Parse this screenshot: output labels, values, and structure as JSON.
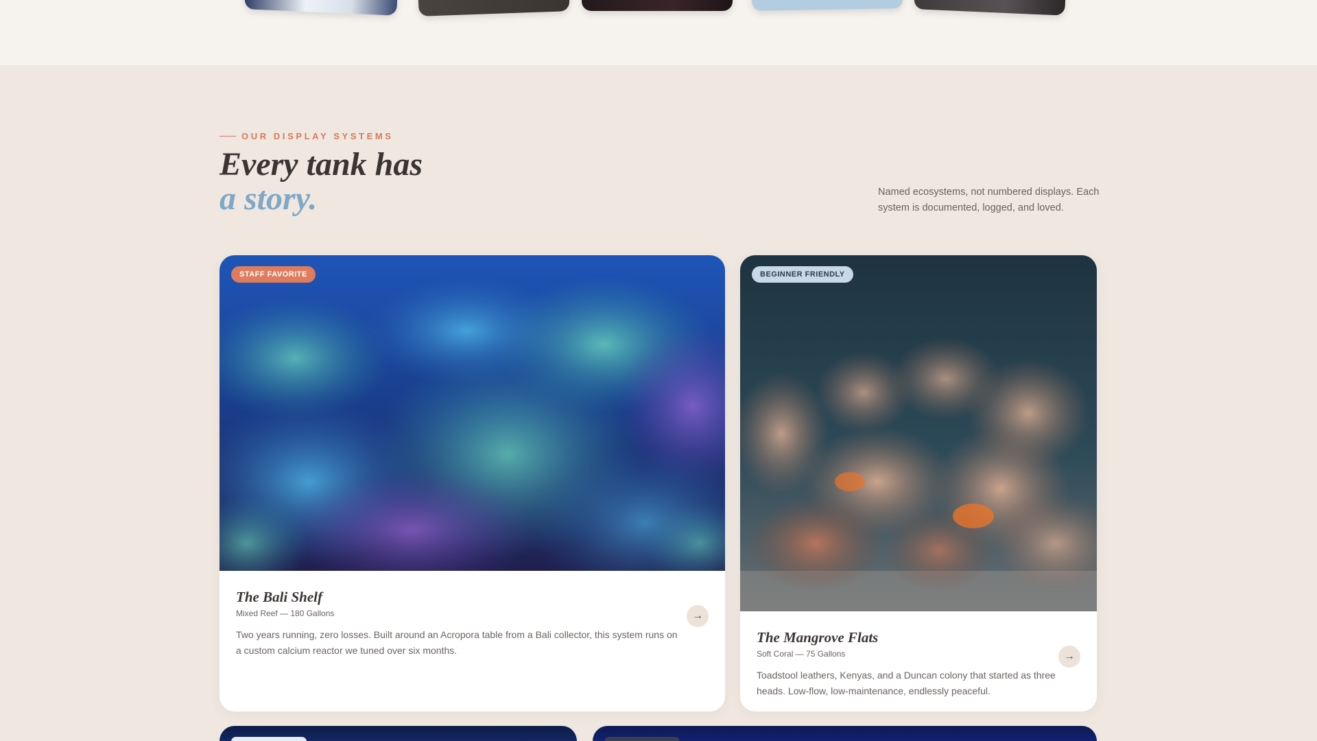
{
  "section": {
    "eyebrow": "OUR DISPLAY SYSTEMS",
    "title_line1": "Every tank has",
    "title_line2": "a story.",
    "intro": "Named ecosystems, not numbered displays. Each system is documented, logged, and loved."
  },
  "cards": [
    {
      "badge": "STAFF FAVORITE",
      "title": "The Bali Shelf",
      "subtitle": "Mixed Reef — 180 Gallons",
      "description": "Two years running, zero losses. Built around an Acropora table from a Bali collector, this system runs on a custom calcium reactor we tuned over six months.",
      "arrow": "→"
    },
    {
      "badge": "BEGINNER FRIENDLY",
      "title": "The Mangrove Flats",
      "subtitle": "Soft Coral — 75 Gallons",
      "description": "Toadstool leathers, Kenyas, and a Duncan colony that started as three heads. Low-flow, low-maintenance, endlessly peaceful.",
      "arrow": "→"
    }
  ],
  "colors": {
    "accent": "#d87a5c",
    "title_accent": "#7fa8c6",
    "background": "#efe7e0",
    "badge_orange": "#e07c5e",
    "badge_blue": "#c7d8e6"
  },
  "icons": {
    "card_link": "arrow-right-icon"
  }
}
